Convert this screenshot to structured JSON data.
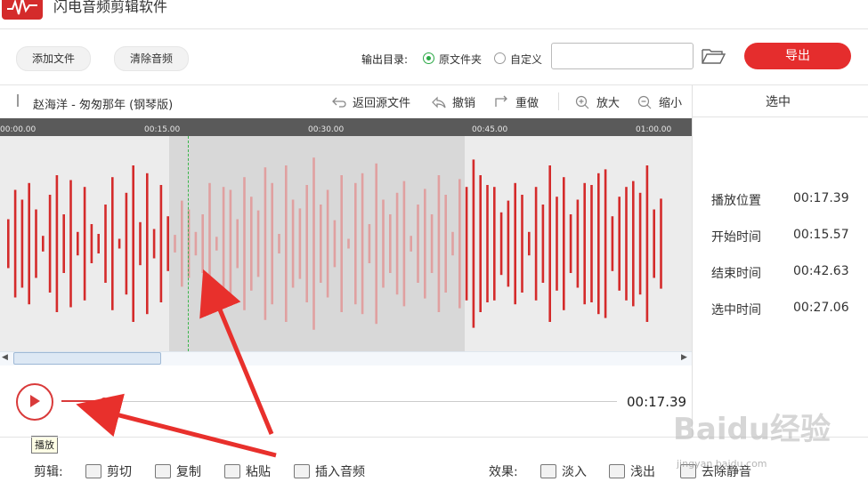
{
  "app": {
    "title": "闪电音频剪辑软件"
  },
  "toolbar": {
    "add_file": "添加文件",
    "clear_audio": "清除音频",
    "output_label": "输出目录:",
    "radio_source": "原文件夹",
    "radio_custom": "自定义",
    "path_value": "",
    "export": "导出"
  },
  "file_bar": {
    "file_name": "赵海洋 - 匆匆那年 (钢琴版)",
    "back_source": "返回源文件",
    "undo": "撤销",
    "redo": "重做",
    "zoom_in": "放大",
    "zoom_out": "缩小"
  },
  "timeline": {
    "ticks": [
      "00:00.00",
      "00:15.00",
      "00:30.00",
      "00:45.00",
      "01:00.00"
    ]
  },
  "selection_panel": {
    "title": "选中",
    "rows": [
      {
        "label": "播放位置",
        "value": "00:17.39"
      },
      {
        "label": "开始时间",
        "value": "00:15.57"
      },
      {
        "label": "结束时间",
        "value": "00:42.63"
      },
      {
        "label": "选中时间",
        "value": "00:27.06"
      }
    ]
  },
  "playback": {
    "time": "00:17.39",
    "tooltip": "播放",
    "progress": 0.075
  },
  "edit_tools": {
    "label": "剪辑:",
    "cut": "剪切",
    "copy": "复制",
    "paste": "粘贴",
    "insert_audio": "插入音频"
  },
  "effect_tools": {
    "label": "效果:",
    "fade_in": "淡入",
    "fade_out": "浅出",
    "remove_silence": "去除静音"
  },
  "watermark": {
    "text": "Baidu经验",
    "sub": "jingyan.baidu.com"
  },
  "colors": {
    "accent": "#e52d2d",
    "wave": "#d42b2b",
    "wave_selected": "#e0a0a0",
    "playhead": "#3ab54a"
  }
}
